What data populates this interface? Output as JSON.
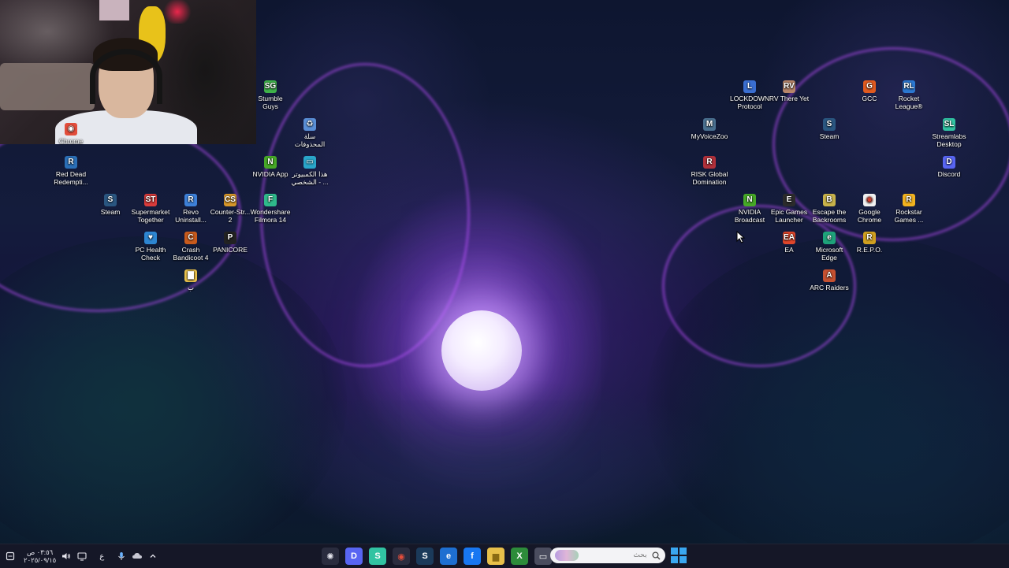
{
  "colors": {
    "taskbar_bg": "#16182a",
    "accent": "#3aa7f0",
    "moon_glow": "#c9a2ff"
  },
  "webcam": {
    "label": "webcam-overlay"
  },
  "desktop_icons": [
    {
      "name": "stumble-guys",
      "label": "Stumble Guys",
      "icon": "SG",
      "color": "#3fb24a"
    },
    {
      "name": "recycle-bin",
      "label": "سلة المحذوفات",
      "icon": "♻",
      "color": "#5a8fd6"
    },
    {
      "name": "chrome-top",
      "label": "Chrome",
      "icon": "◉",
      "color": "#e24d3b"
    },
    {
      "name": "red-dead",
      "label": "Red Dead Redempti...",
      "icon": "R",
      "color": "#2b6fb6"
    },
    {
      "name": "nvidia-app",
      "label": "NVIDIA App",
      "icon": "N",
      "color": "#46a827"
    },
    {
      "name": "this-pc",
      "label": "هذا الكمبيوتر الشخصي - ...",
      "icon": "▭",
      "color": "#2aa6c9"
    },
    {
      "name": "steam-left",
      "label": "Steam",
      "icon": "S",
      "color": "#2a5680"
    },
    {
      "name": "supermarket",
      "label": "Supermarket Together",
      "icon": "ST",
      "color": "#d83b3b"
    },
    {
      "name": "revo",
      "label": "Revo Uninstall...",
      "icon": "R",
      "color": "#3d80d8"
    },
    {
      "name": "counter-strike",
      "label": "Counter-Str... 2",
      "icon": "CS",
      "color": "#d6962a"
    },
    {
      "name": "filmora",
      "label": "Wondershare Filmora 14",
      "icon": "F",
      "color": "#2fb98b"
    },
    {
      "name": "pc-health",
      "label": "PC Health Check",
      "icon": "♥",
      "color": "#2d86d2"
    },
    {
      "name": "crash-bandicoot",
      "label": "Crash Bandicoot 4",
      "icon": "C",
      "color": "#c75a1c"
    },
    {
      "name": "panicore",
      "label": "PANICORE",
      "icon": "P",
      "color": "#222222"
    },
    {
      "name": "folder-b",
      "label": "ب",
      "icon": "▇",
      "color": "#e8c04a"
    },
    {
      "name": "lockdown",
      "label": "LOCKDOWN Protocol",
      "icon": "L",
      "color": "#3a6ed1"
    },
    {
      "name": "rv-there-yet",
      "label": "RV There Yet",
      "icon": "RV",
      "color": "#b8866a"
    },
    {
      "name": "gcc",
      "label": "GCC",
      "icon": "G",
      "color": "#e05a1f"
    },
    {
      "name": "rocket-league",
      "label": "Rocket League®",
      "icon": "RL",
      "color": "#2b78d1"
    },
    {
      "name": "myvoicezoo",
      "label": "MyVoiceZoo",
      "icon": "M",
      "color": "#4a7090"
    },
    {
      "name": "steam-right",
      "label": "Steam",
      "icon": "S",
      "color": "#2a5680"
    },
    {
      "name": "streamlabs",
      "label": "Streamlabs Desktop",
      "icon": "SL",
      "color": "#31c3a2"
    },
    {
      "name": "risk",
      "label": "RISK Global Domination",
      "icon": "R",
      "color": "#b0303a"
    },
    {
      "name": "discord",
      "label": "Discord",
      "icon": "D",
      "color": "#5865f2"
    },
    {
      "name": "nvidia-broadcast",
      "label": "NVIDIA Broadcast",
      "icon": "N",
      "color": "#46a827"
    },
    {
      "name": "epic-games",
      "label": "Epic Games Launcher",
      "icon": "E",
      "color": "#2b2b2b"
    },
    {
      "name": "escape-backrooms",
      "label": "Escape the Backrooms",
      "icon": "B",
      "color": "#c8b24a"
    },
    {
      "name": "google-chrome",
      "label": "Google Chrome",
      "icon": "◉",
      "color": "#f1f1f1"
    },
    {
      "name": "rockstar",
      "label": "Rockstar Games ...",
      "icon": "R",
      "color": "#f2b31f"
    },
    {
      "name": "ea",
      "label": "EA",
      "icon": "EA",
      "color": "#e0462b"
    },
    {
      "name": "edge",
      "label": "Microsoft Edge",
      "icon": "e",
      "color": "#1ea27a"
    },
    {
      "name": "repo",
      "label": "R.E.P.O.",
      "icon": "R",
      "color": "#d0a020"
    },
    {
      "name": "arc-raiders",
      "label": "ARC Raiders",
      "icon": "A",
      "color": "#c45030"
    }
  ],
  "taskbar": {
    "clock_time": "٠٣:٥٦ ص",
    "clock_date": "٢٠٢٥/٠٩/١٥",
    "lang": "ع",
    "search_placeholder": "بحث",
    "tray_icons": [
      "settings-icon",
      "volume-icon",
      "network-icon",
      "mic-icon",
      "cloud-icon",
      "chevron-up-icon"
    ],
    "apps": [
      {
        "name": "settings",
        "icon": "✺",
        "color": "#2a2c3e",
        "fg": "#e6e6ee"
      },
      {
        "name": "discord",
        "icon": "D",
        "color": "#5865f2",
        "fg": "#ffffff"
      },
      {
        "name": "streamlabs",
        "icon": "S",
        "color": "#31c3a2",
        "fg": "#ffffff"
      },
      {
        "name": "chrome",
        "icon": "◉",
        "color": "#2a2c3e",
        "fg": "#e24d3b"
      },
      {
        "name": "steam",
        "icon": "S",
        "color": "#1b3a5a",
        "fg": "#ffffff"
      },
      {
        "name": "edge",
        "icon": "e",
        "color": "#1e6fd1",
        "fg": "#ffffff"
      },
      {
        "name": "facebook",
        "icon": "f",
        "color": "#1877f2",
        "fg": "#ffffff"
      },
      {
        "name": "file-explorer",
        "icon": "▆",
        "color": "#e8c04a",
        "fg": "#8a6a12"
      },
      {
        "name": "xbox",
        "icon": "X",
        "color": "#2d8c3a",
        "fg": "#ffffff"
      },
      {
        "name": "terminal",
        "icon": "▭",
        "color": "#4a4c5e",
        "fg": "#ffffff"
      }
    ]
  }
}
